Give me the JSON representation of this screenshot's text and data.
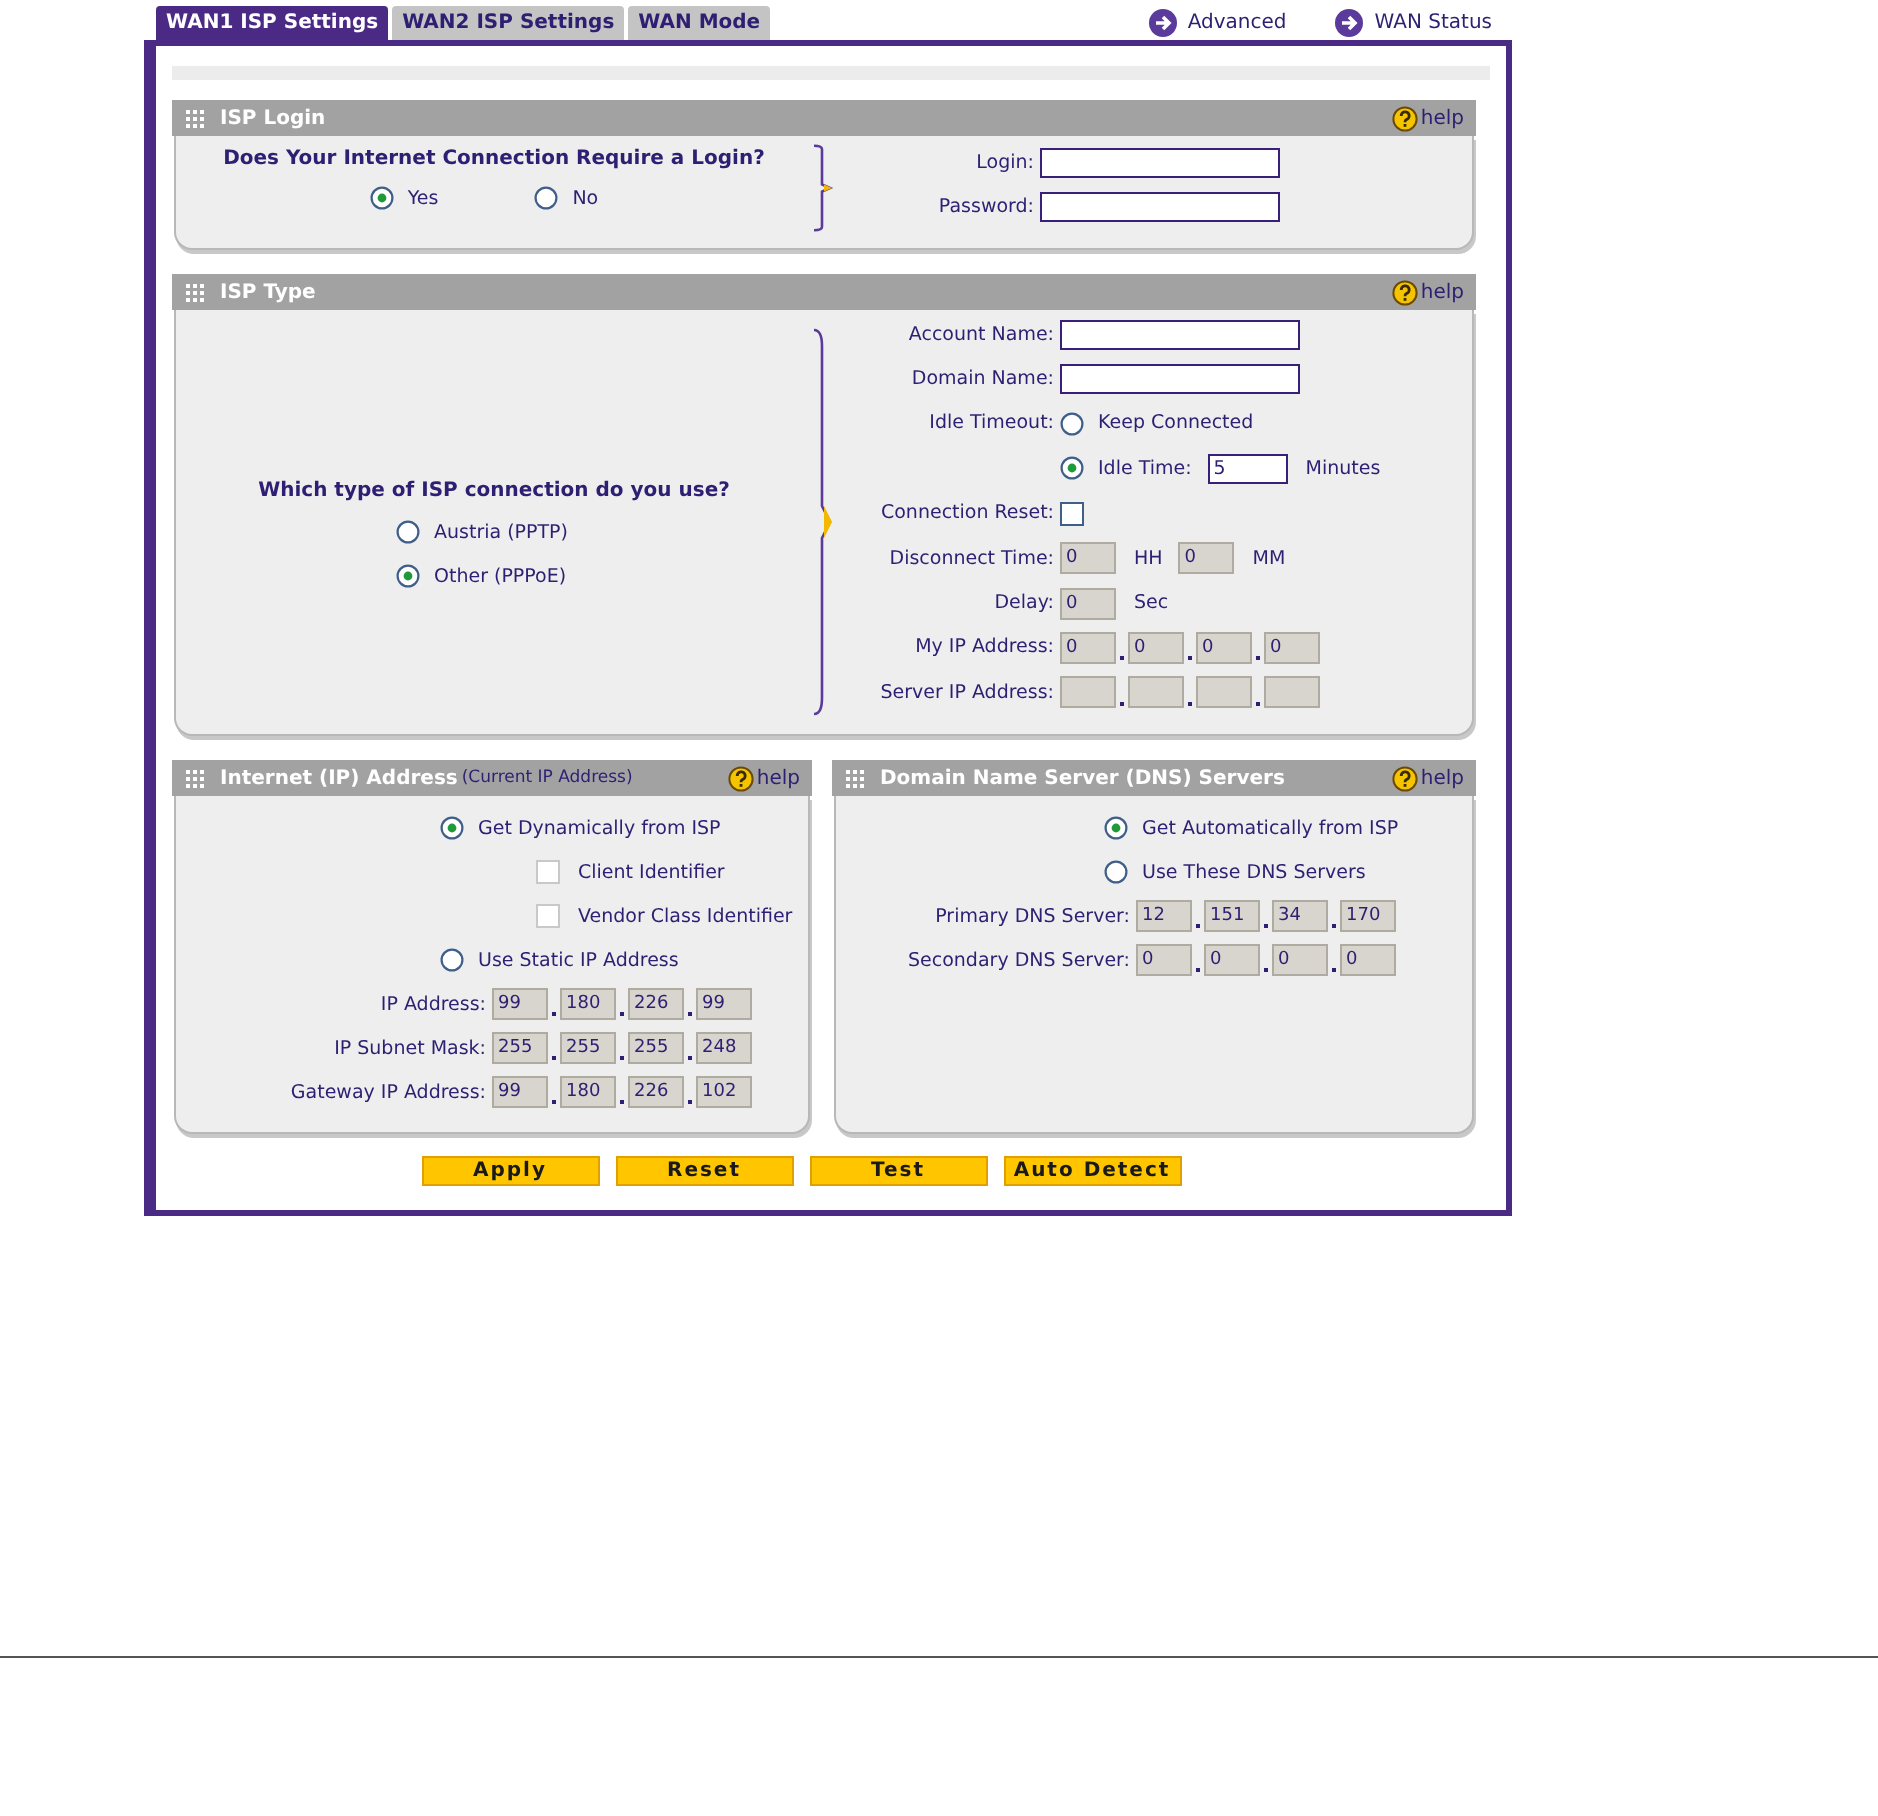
{
  "tabs": [
    {
      "label": "WAN1 ISP Settings",
      "selected": true
    },
    {
      "label": "WAN2 ISP Settings",
      "selected": false
    },
    {
      "label": "WAN Mode",
      "selected": false
    }
  ],
  "links": [
    {
      "label": "Advanced"
    },
    {
      "label": "WAN Status"
    }
  ],
  "sections": [
    {
      "kind": "split_row",
      "title": "ISP Login",
      "help": "help",
      "question": "Does Your Internet Connection Require a Login?",
      "options": [
        {
          "label": "Yes",
          "selected": true
        },
        {
          "label": "No",
          "selected": false
        }
      ],
      "rows": [
        {
          "kind": "field",
          "label": "Login:"
        },
        {
          "kind": "field",
          "label": "Password:"
        }
      ]
    },
    {
      "kind": "split_column",
      "title": "ISP Type",
      "help": "help",
      "question": "Which type of ISP connection do you use?",
      "options": [
        {
          "label": "Austria (PPTP)",
          "selected": false
        },
        {
          "label": "Other (PPPoE)",
          "selected": true
        }
      ],
      "rows": [
        {
          "kind": "field",
          "label": "Account Name:"
        },
        {
          "kind": "field",
          "label": "Domain Name:"
        },
        {
          "kind": "radio",
          "label": "Idle Timeout:",
          "option": "Keep Connected",
          "selected": false
        },
        {
          "kind": "radio",
          "option": "Idle Time:",
          "selected": true,
          "value": "5",
          "unit": "Minutes"
        },
        {
          "kind": "checkbox",
          "label": "Connection Reset:",
          "checked": false
        },
        {
          "kind": "time",
          "label": "Disconnect Time:",
          "parts": [
            {
              "value": "0",
              "unit": "HH"
            },
            {
              "value": "0",
              "unit": "MM"
            }
          ]
        },
        {
          "kind": "time",
          "label": "Delay:",
          "parts": [
            {
              "value": "0",
              "unit": "Sec"
            }
          ]
        },
        {
          "kind": "ip",
          "label": "My IP Address:",
          "octets": [
            "0",
            "0",
            "0",
            "0"
          ]
        },
        {
          "kind": "ip_blank",
          "label": "Server IP Address:"
        }
      ]
    },
    {
      "kind": "rows",
      "title": "Internet (IP) Address",
      "subtitle": "(Current IP Address)",
      "help": "help",
      "rows": [
        {
          "kind": "radio",
          "option": "Get Dynamically from ISP",
          "selected": true,
          "children": [
            {
              "kind": "checkbox",
              "option": "Client Identifier",
              "checked": false
            },
            {
              "kind": "checkbox",
              "option": "Vendor Class Identifier",
              "checked": false
            }
          ]
        },
        {
          "kind": "radio",
          "option": "Use Static IP Address",
          "selected": false
        },
        {
          "kind": "ip",
          "label": "IP Address:",
          "octets": [
            "99",
            "180",
            "226",
            "99"
          ]
        },
        {
          "kind": "ip",
          "label": "IP Subnet Mask:",
          "octets": [
            "255",
            "255",
            "255",
            "248"
          ]
        },
        {
          "kind": "ip",
          "label": "Gateway IP Address:",
          "octets": [
            "99",
            "180",
            "226",
            "102"
          ]
        }
      ]
    },
    {
      "kind": "rows",
      "title": "Domain Name Server (DNS) Servers",
      "help": "help",
      "rows": [
        {
          "kind": "radio",
          "option": "Get Automatically from ISP",
          "selected": true
        },
        {
          "kind": "radio",
          "option": "Use These DNS Servers",
          "selected": false
        },
        {
          "kind": "ip",
          "label": "Primary DNS Server:",
          "octets": [
            "12",
            "151",
            "34",
            "170"
          ]
        },
        {
          "kind": "ip",
          "label": "Secondary DNS Server:",
          "octets": [
            "0",
            "0",
            "0",
            "0"
          ]
        }
      ]
    }
  ],
  "buttons": [
    {
      "label": "Apply"
    },
    {
      "label": "Reset"
    },
    {
      "label": "Test"
    },
    {
      "label": "Auto Detect"
    }
  ]
}
